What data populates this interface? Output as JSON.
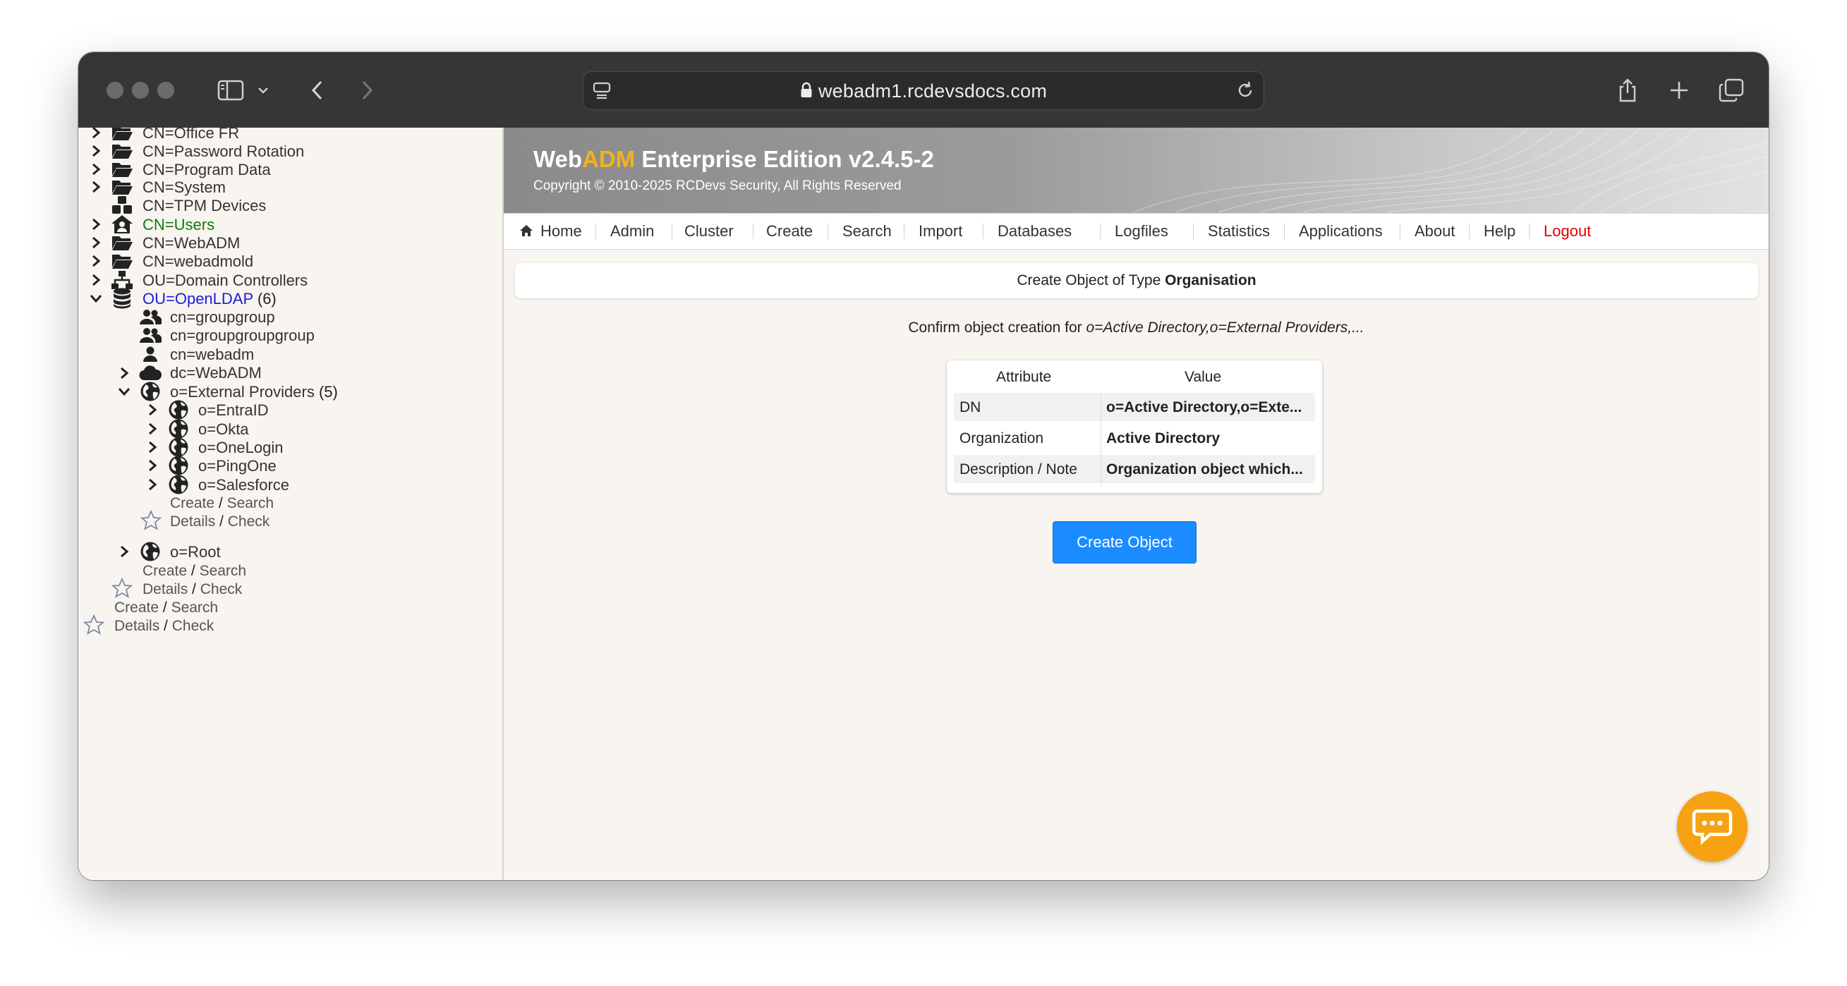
{
  "browser": {
    "url": "webadm1.rcdevsdocs.com"
  },
  "sidebar": {
    "rows": [
      {
        "label": "CN=Office FR"
      },
      {
        "label": "CN=Password Rotation"
      },
      {
        "label": "CN=Program Data"
      },
      {
        "label": "CN=System"
      },
      {
        "label": "CN=TPM Devices"
      },
      {
        "label": "CN=Users"
      },
      {
        "label": "CN=WebADM"
      },
      {
        "label": "CN=webadmold"
      },
      {
        "label": "OU=Domain Controllers"
      },
      {
        "label": "OU=OpenLDAP",
        "count": "(6)"
      },
      {
        "label": "cn=groupgroup"
      },
      {
        "label": "cn=groupgroupgroup"
      },
      {
        "label": "cn=webadm"
      },
      {
        "label": "dc=WebADM"
      },
      {
        "label": "o=External Providers",
        "count": "(5)"
      },
      {
        "label": "o=EntraID"
      },
      {
        "label": "o=Okta"
      },
      {
        "label": "o=OneLogin"
      },
      {
        "label": "o=PingOne"
      },
      {
        "label": "o=Salesforce"
      },
      {
        "label": "o=Root"
      }
    ],
    "links": {
      "create": "Create",
      "search": "Search",
      "details": "Details",
      "check": "Check",
      "slash": "/"
    }
  },
  "banner": {
    "title_web": "Web",
    "title_adm": "ADM",
    "title_rest": " Enterprise Edition v2.4.5-2",
    "copyright": "Copyright © 2010-2025 RCDevs Security, All Rights Reserved"
  },
  "menu": {
    "items": [
      "Home",
      "Admin",
      "Cluster",
      "Create",
      "Search",
      "Import",
      "Databases",
      "Logfiles",
      "Statistics",
      "Applications",
      "About",
      "Help",
      "Logout"
    ]
  },
  "content": {
    "panel_title_prefix": "Create Object of Type ",
    "panel_title_type": "Organisation",
    "confirm_prefix": "Confirm object creation for ",
    "confirm_dn": "o=Active Directory,o=External Providers,...",
    "table": {
      "headers": [
        "Attribute",
        "Value"
      ],
      "rows": [
        {
          "attr": "DN",
          "value": "o=Active Directory,o=Exte..."
        },
        {
          "attr": "Organization",
          "value": "Active Directory"
        },
        {
          "attr": "Description / Note",
          "value": "Organization object which..."
        }
      ]
    },
    "create_button": "Create Object"
  },
  "colors": {
    "accent": "#1a8cff",
    "brand_adm": "#f4b21a",
    "logout": "#e00000",
    "users_green": "#0a7d10",
    "openldap_blue": "#1d1dd6",
    "chat": "#f6a212"
  }
}
